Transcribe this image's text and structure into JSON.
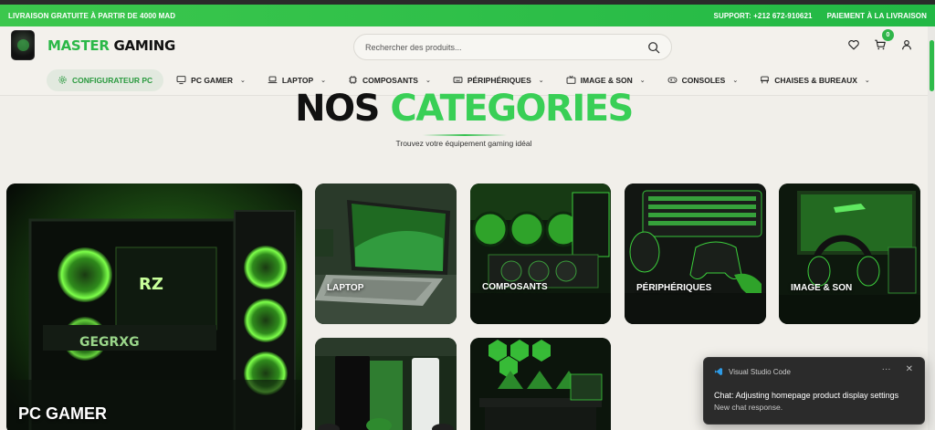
{
  "promo": {
    "left": "LIVRAISON GRATUITE À PARTIR DE 4000 MAD",
    "support": "SUPPORT: +212 672-910621",
    "payment": "PAIEMENT À LA LIVRAISON"
  },
  "header": {
    "brand_green": "MASTER",
    "brand_dark": "GAMING",
    "search_placeholder": "Rechercher des produits...",
    "cart_count": "0"
  },
  "nav": [
    {
      "label": "CONFIGURATEUR PC",
      "icon": "gear-icon",
      "dropdown": false
    },
    {
      "label": "PC GAMER",
      "icon": "monitor-icon",
      "dropdown": true
    },
    {
      "label": "LAPTOP",
      "icon": "laptop-icon",
      "dropdown": true
    },
    {
      "label": "COMPOSANTS",
      "icon": "cpu-icon",
      "dropdown": true
    },
    {
      "label": "PÉRIPHÉRIQUES",
      "icon": "keyboard-icon",
      "dropdown": true
    },
    {
      "label": "IMAGE & SON",
      "icon": "tv-icon",
      "dropdown": true
    },
    {
      "label": "CONSOLES",
      "icon": "gamepad-icon",
      "dropdown": true
    },
    {
      "label": "CHAISES & BUREAUX",
      "icon": "chair-icon",
      "dropdown": true
    }
  ],
  "section": {
    "title_dark": "NOS",
    "title_green": "CATEGORIES",
    "subtitle": "Trouvez votre équipement gaming idéal"
  },
  "categories": [
    {
      "label": "PC GAMER"
    },
    {
      "label": "LAPTOP"
    },
    {
      "label": "COMPOSANTS"
    },
    {
      "label": "PÉRIPHÉRIQUES"
    },
    {
      "label": "IMAGE & SON"
    },
    {
      "label": ""
    },
    {
      "label": ""
    }
  ],
  "toast": {
    "app": "Visual Studio Code",
    "more": "···",
    "close": "✕",
    "message": "Chat: Adjusting homepage product display settings",
    "sub": "New chat response."
  },
  "colors": {
    "accent": "#2fb64a",
    "title_green": "#39cf56"
  }
}
